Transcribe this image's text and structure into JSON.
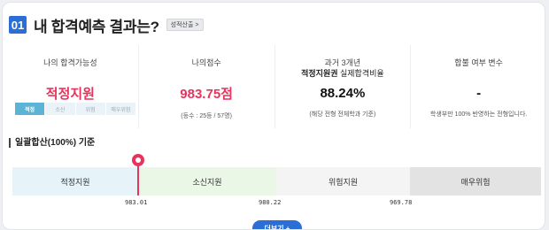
{
  "header": {
    "number": "01",
    "title": "내 합격예측 결과는?",
    "detail_button": "성적산출",
    "detail_chevron": ">"
  },
  "stats": [
    {
      "label": "나의 합격가능성",
      "value": "적정지원"
    },
    {
      "label": "나의점수",
      "value": "983.75점",
      "note": "(등수 : 25등 / 57명)"
    },
    {
      "label": "과거 3개년",
      "sublabel_bold": "적정지원권",
      "sublabel_rest": " 실제합격비율",
      "value": "88.24%",
      "note": "(해당 전형 전체학과 기준)"
    },
    {
      "label": "합불 여부 변수",
      "value": "-",
      "note": "학생부만 100% 반영하는 전형입니다."
    }
  ],
  "segments": [
    "적정",
    "소신",
    "위험",
    "매우위험"
  ],
  "section_title": "일괄합산(100%) 기준",
  "zones": [
    "적정지원",
    "소신지원",
    "위험지원",
    "매우위험"
  ],
  "ticks": [
    "983.01",
    "980.22",
    "969.78"
  ],
  "more_button": "더보기 +"
}
